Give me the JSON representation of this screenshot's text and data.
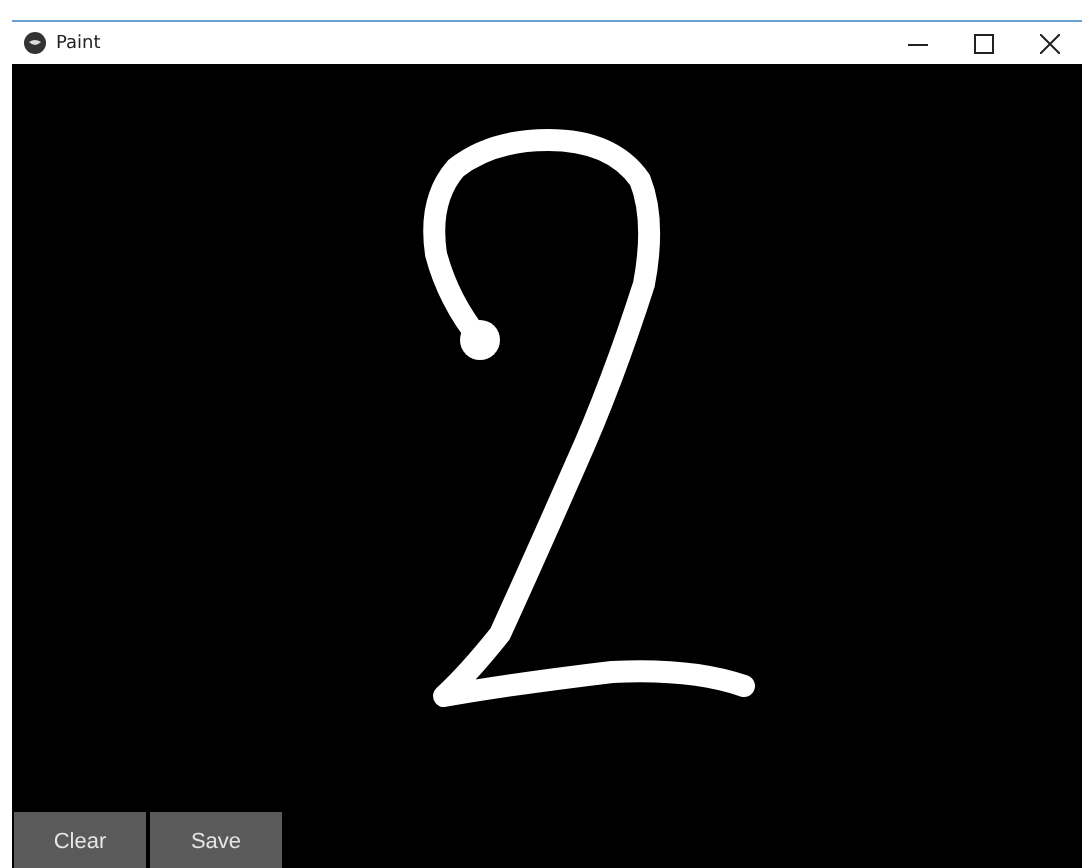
{
  "window": {
    "title": "Paint"
  },
  "buttons": [
    {
      "label": "Clear"
    },
    {
      "label": "Save"
    }
  ]
}
